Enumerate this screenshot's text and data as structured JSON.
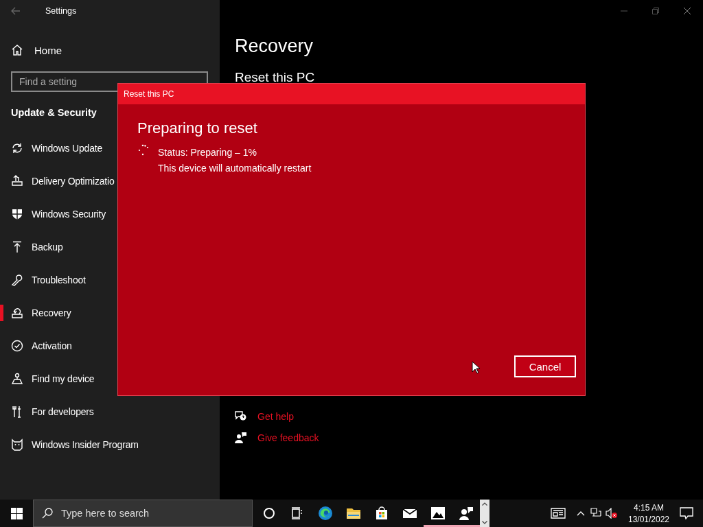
{
  "window": {
    "title": "Settings"
  },
  "sidebar": {
    "home": "Home",
    "search": {
      "placeholder": "Find a setting"
    },
    "section": "Update & Security",
    "items": [
      {
        "label": "Windows Update",
        "selected": false
      },
      {
        "label": "Delivery Optimizatio",
        "selected": false
      },
      {
        "label": "Windows Security",
        "selected": false
      },
      {
        "label": "Backup",
        "selected": false
      },
      {
        "label": "Troubleshoot",
        "selected": false
      },
      {
        "label": "Recovery",
        "selected": true
      },
      {
        "label": "Activation",
        "selected": false
      },
      {
        "label": "Find my device",
        "selected": false
      },
      {
        "label": "For developers",
        "selected": false
      },
      {
        "label": "Windows Insider Program",
        "selected": false
      }
    ]
  },
  "content": {
    "title": "Recovery",
    "heading": "Reset this PC",
    "links": [
      "Get help",
      "Give feedback"
    ]
  },
  "dialog": {
    "title": "Reset this PC",
    "heading": "Preparing to reset",
    "status": "Status: Preparing – 1%",
    "note": "This device will automatically restart",
    "buttons": [
      "Cancel"
    ]
  },
  "taskbar": {
    "search": {
      "placeholder": "Type here to search"
    },
    "apps": [
      {
        "running": false
      },
      {
        "running": false
      },
      {
        "running": false
      },
      {
        "running": false
      },
      {
        "running": false
      },
      {
        "running": false
      },
      {
        "running": true
      },
      {
        "running": true
      }
    ],
    "clock": {
      "time": "4:15 AM",
      "date": "13/01/2022"
    }
  }
}
